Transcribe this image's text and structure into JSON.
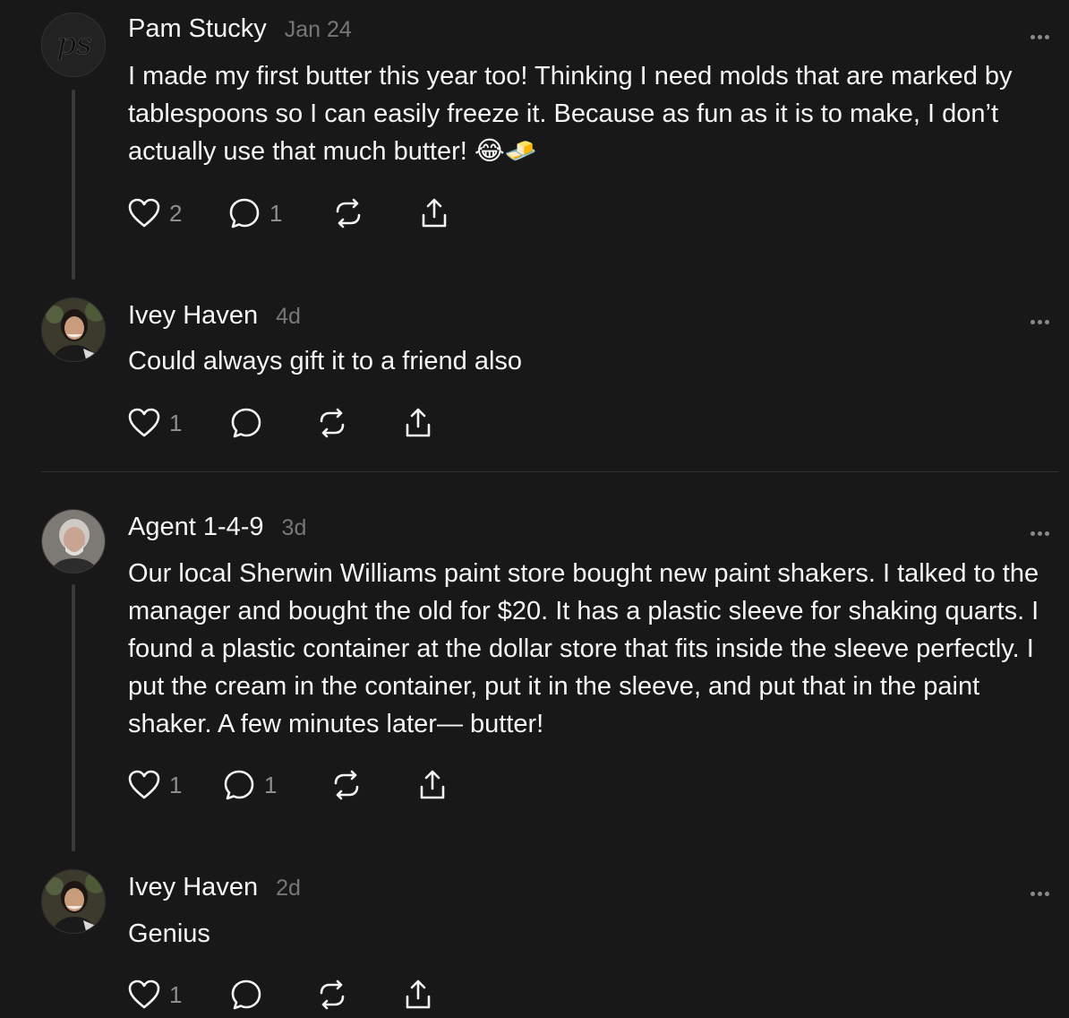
{
  "posts": [
    {
      "author": "Pam Stucky",
      "time": "Jan 24",
      "avatar": "pam-stucky-avatar",
      "avatar_text": "ps",
      "text": "I made my first butter this year too! Thinking I need molds that are marked by tablespoons so I can easily freeze it. Because as fun as it is to make, I don’t actually use that much butter! 😂🧈",
      "likes": "2",
      "replies": "1"
    },
    {
      "author": "Ivey Haven",
      "time": "4d",
      "avatar": "ivey-haven-avatar",
      "text": "Could always gift it to a friend also",
      "likes": "1",
      "replies": ""
    },
    {
      "author": "Agent 1-4-9",
      "time": "3d",
      "avatar": "agent-149-avatar",
      "text": "Our local Sherwin Williams paint store bought new paint shakers. I talked to the manager and bought the old for $20. It has a plastic sleeve for shaking quarts. I found a plastic container at the dollar store that fits inside the sleeve perfectly. I put the cream in the container, put it in the sleeve, and put that in the paint shaker. A few minutes later— butter!",
      "likes": "1",
      "replies": "1"
    },
    {
      "author": "Ivey Haven",
      "time": "2d",
      "avatar": "ivey-haven-avatar",
      "text": "Genius",
      "likes": "1",
      "replies": ""
    }
  ],
  "icons": {
    "like": "heart-icon",
    "reply": "comment-icon",
    "repost": "repost-icon",
    "share": "share-icon",
    "more": "more-options-icon"
  },
  "colors": {
    "background": "#181818",
    "text": "#f3f5f7",
    "muted": "#777777",
    "thread_line": "#3a3a3a"
  }
}
